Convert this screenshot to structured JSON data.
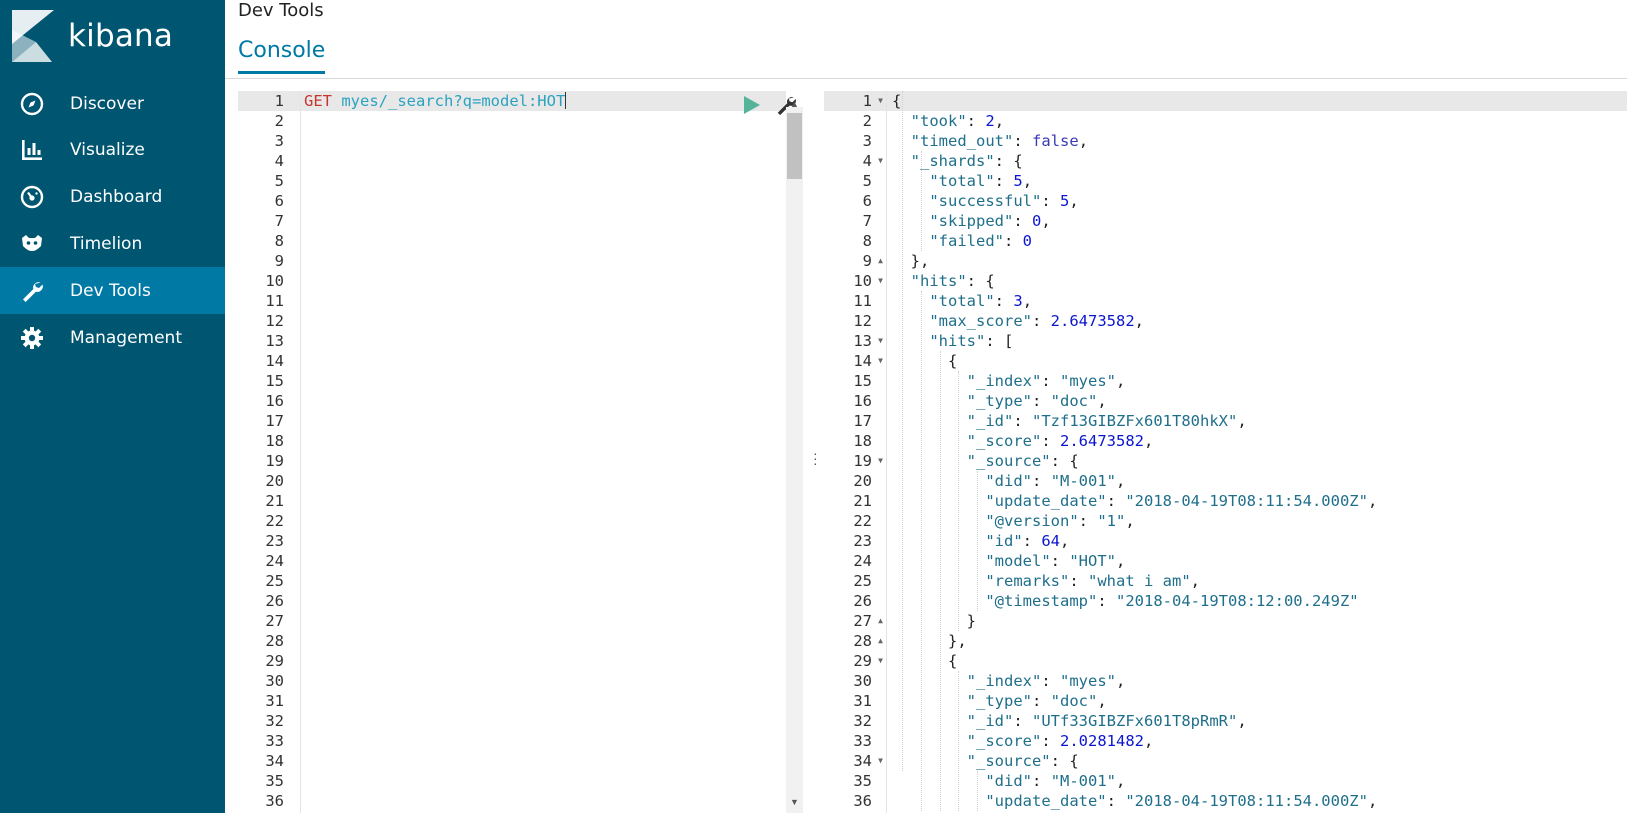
{
  "brand": {
    "name": "kibana"
  },
  "sidebar": {
    "items": [
      {
        "label": "Discover",
        "icon": "compass-icon",
        "active": false
      },
      {
        "label": "Visualize",
        "icon": "bar-chart-icon",
        "active": false
      },
      {
        "label": "Dashboard",
        "icon": "dashboard-gauge-icon",
        "active": false
      },
      {
        "label": "Timelion",
        "icon": "timelion-mask-icon",
        "active": false
      },
      {
        "label": "Dev Tools",
        "icon": "wrench-icon",
        "active": true
      },
      {
        "label": "Management",
        "icon": "gear-icon",
        "active": false
      }
    ]
  },
  "header": {
    "app_title": "Dev Tools",
    "tab": "Console"
  },
  "request": {
    "method": "GET",
    "url": "myes/_search?q=model:HOT",
    "line_count": 36
  },
  "response": {
    "lines": [
      "{",
      "  \"took\": 2,",
      "  \"timed_out\": false,",
      "  \"_shards\": {",
      "    \"total\": 5,",
      "    \"successful\": 5,",
      "    \"skipped\": 0,",
      "    \"failed\": 0",
      "  },",
      "  \"hits\": {",
      "    \"total\": 3,",
      "    \"max_score\": 2.6473582,",
      "    \"hits\": [",
      "      {",
      "        \"_index\": \"myes\",",
      "        \"_type\": \"doc\",",
      "        \"_id\": \"Tzf13GIBZFx601T80hkX\",",
      "        \"_score\": 2.6473582,",
      "        \"_source\": {",
      "          \"did\": \"M-001\",",
      "          \"update_date\": \"2018-04-19T08:11:54.000Z\",",
      "          \"@version\": \"1\",",
      "          \"id\": 64,",
      "          \"model\": \"HOT\",",
      "          \"remarks\": \"what i am\",",
      "          \"@timestamp\": \"2018-04-19T08:12:00.249Z\"",
      "        }",
      "      },",
      "      {",
      "        \"_index\": \"myes\",",
      "        \"_type\": \"doc\",",
      "        \"_id\": \"UTf33GIBZFx601T8pRmR\",",
      "        \"_score\": 2.0281482,",
      "        \"_source\": {",
      "          \"did\": \"M-001\",",
      "          \"update_date\": \"2018-04-19T08:11:54.000Z\","
    ],
    "fold_open_lines": [
      1,
      4,
      10,
      13,
      14,
      19,
      29,
      34
    ],
    "fold_close_lines": [
      9,
      27,
      28
    ]
  },
  "colors": {
    "sidebar_bg": "#005571",
    "sidebar_active": "#0079a5",
    "accent": "#0079a5",
    "run_green": "#54b399"
  }
}
